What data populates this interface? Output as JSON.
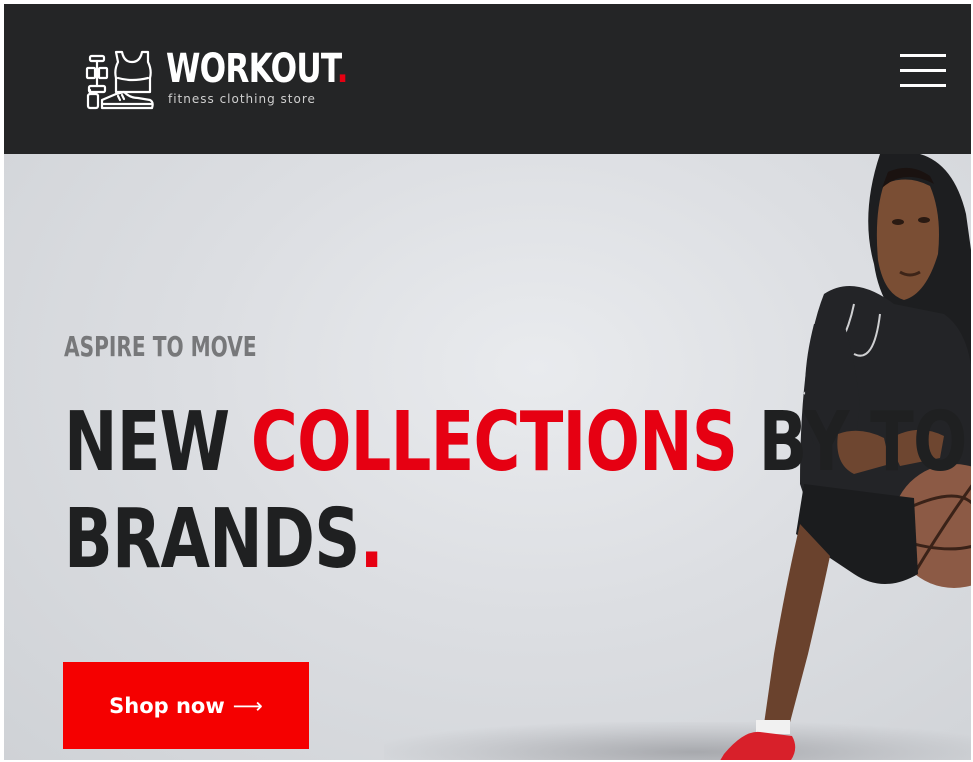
{
  "header": {
    "logo_title": "WORKOUT",
    "logo_dot": ".",
    "logo_tagline": "fitness clothing store",
    "menu_icon": "hamburger-menu-icon"
  },
  "hero": {
    "kicker": "ASPIRE TO MOVE",
    "headline_part1": "NEW ",
    "headline_accent": "COLLECTIONS",
    "headline_part2": " BY TOP",
    "headline_line2": "BRANDS",
    "headline_dot": ".",
    "cta_label": "Shop now",
    "cta_arrow": "⟶"
  },
  "colors": {
    "header_bg": "#242526",
    "accent": "#e60012",
    "button_bg": "#f50000",
    "headline_text": "#1f2021",
    "kicker_text": "#77787a"
  }
}
